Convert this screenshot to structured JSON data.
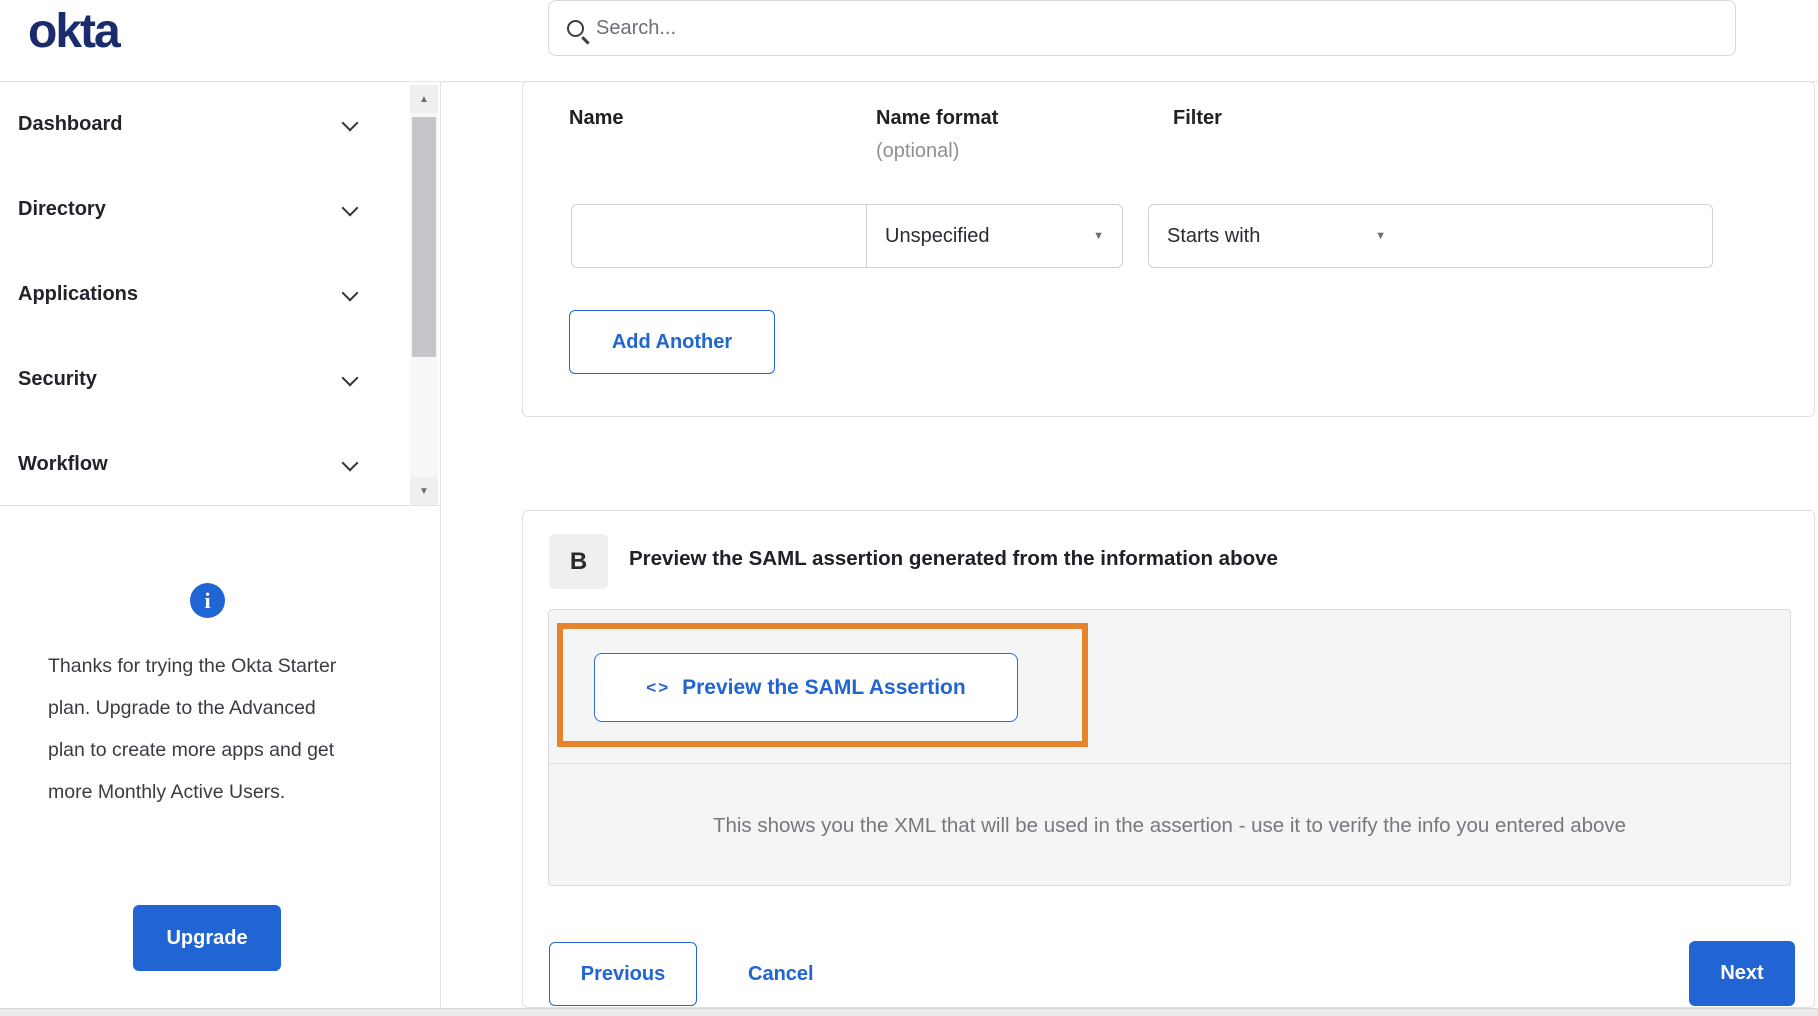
{
  "header": {
    "logo": "okta",
    "search_placeholder": "Search..."
  },
  "sidebar": {
    "items": [
      {
        "label": "Dashboard"
      },
      {
        "label": "Directory"
      },
      {
        "label": "Applications"
      },
      {
        "label": "Security"
      },
      {
        "label": "Workflow"
      }
    ],
    "info_text": "Thanks for trying the Okta Starter plan. Upgrade to the Advanced plan to create more apps and get more Monthly Active Users.",
    "info_icon_glyph": "i",
    "upgrade_label": "Upgrade"
  },
  "form": {
    "name_label": "Name",
    "name_format_label": "Name format",
    "name_format_optional": "(optional)",
    "filter_label": "Filter",
    "name_value": "",
    "name_format_value": "Unspecified",
    "filter_type_value": "Starts with",
    "filter_value": "",
    "add_another_label": "Add Another"
  },
  "section_b": {
    "badge": "B",
    "heading": "Preview the SAML assertion generated from the information above",
    "preview_icon_glyph": "<>",
    "preview_button_label": "Preview the SAML Assertion",
    "description": "This shows you the XML that will be used in the assertion - use it to verify the info you entered above"
  },
  "footer": {
    "previous_label": "Previous",
    "cancel_label": "Cancel",
    "next_label": "Next"
  },
  "colors": {
    "accent_blue": "#2164d4",
    "logo_navy": "#1a2c6d",
    "annotation_orange": "#e7842b",
    "panel_grey": "#f5f5f6"
  }
}
